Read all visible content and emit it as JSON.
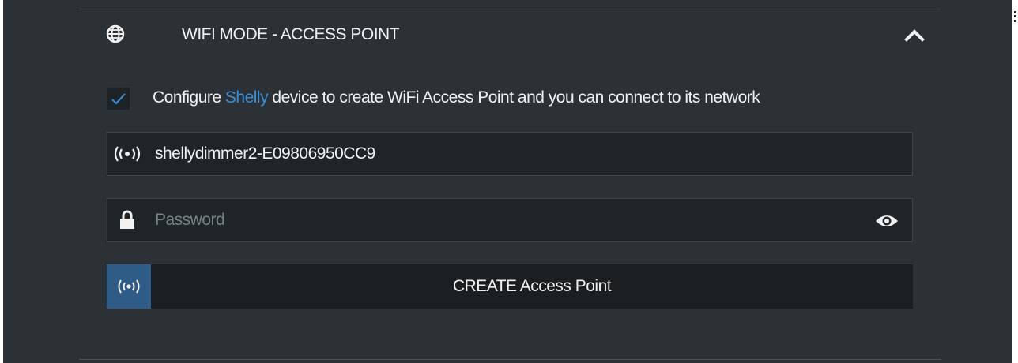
{
  "section": {
    "title": "WIFI MODE - ACCESS POINT",
    "icon": "globe-icon",
    "collapse_icon": "chevron-up-icon",
    "expanded": true
  },
  "option": {
    "checked": true,
    "text_before": "Configure ",
    "brand": "Shelly",
    "text_after": " device to create WiFi Access Point and you can connect to its network"
  },
  "ssid": {
    "icon": "wifi-broadcast-icon",
    "value": "shellydimmer2-E09806950CC9"
  },
  "password": {
    "icon": "lock-icon",
    "value": "",
    "placeholder": "Password",
    "reveal_icon": "eye-icon"
  },
  "create_button": {
    "icon": "wifi-broadcast-icon",
    "label": "CREATE Access Point"
  },
  "colors": {
    "panel_bg": "#2b3135",
    "field_bg": "#1f2428",
    "brand_link": "#3b8fd6",
    "button_accent": "#2f5c86",
    "text": "#f2f2f2",
    "placeholder": "#7b8286"
  }
}
